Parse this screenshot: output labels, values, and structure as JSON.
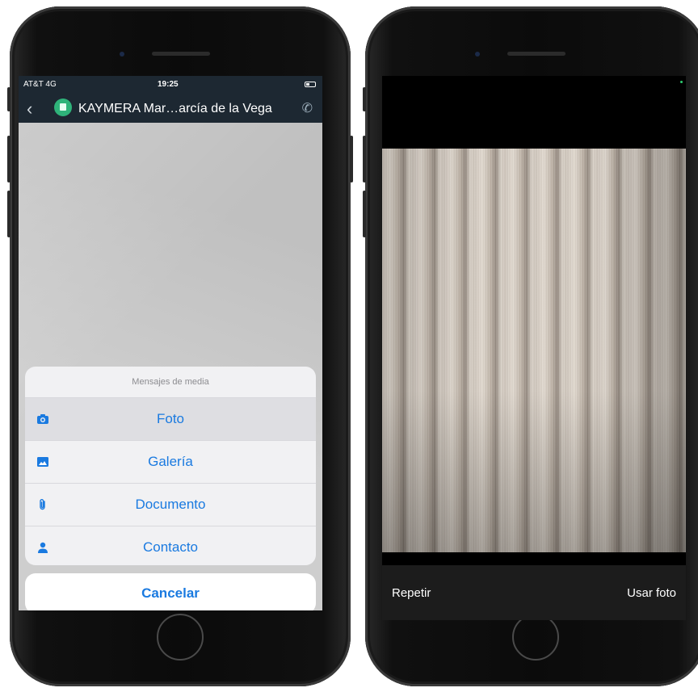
{
  "left_phone": {
    "status_bar": {
      "carrier": "AT&T 4G",
      "time": "19:25"
    },
    "navbar": {
      "contact_title": "KAYMERA Mar…arcía de la Vega"
    },
    "action_sheet": {
      "heading": "Mensajes de media",
      "options": [
        {
          "label": "Foto",
          "icon": "camera-icon"
        },
        {
          "label": "Galería",
          "icon": "gallery-icon"
        },
        {
          "label": "Documento",
          "icon": "paperclip-icon"
        },
        {
          "label": "Contacto",
          "icon": "person-icon"
        }
      ],
      "cancel_label": "Cancelar"
    }
  },
  "right_phone": {
    "camera_bar": {
      "retake_label": "Repetir",
      "use_photo_label": "Usar foto"
    }
  },
  "colors": {
    "accent": "#1a7ae0",
    "navbar_bg": "#1d2832",
    "shield_green": "#2fb37a"
  }
}
